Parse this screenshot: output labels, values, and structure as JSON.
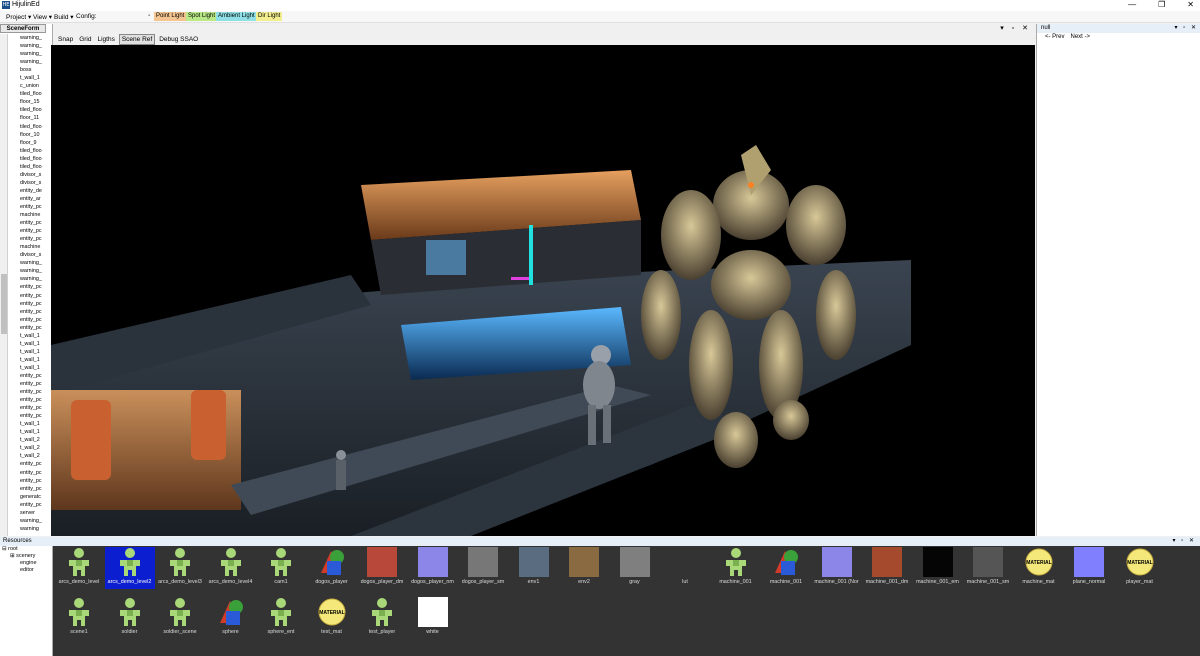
{
  "window": {
    "title": "HijulinEd",
    "app_icon": "HE",
    "btn_minimize": "—",
    "btn_maximize": "❐",
    "btn_close": "✕"
  },
  "menu": {
    "project": "Project ▾",
    "view": "View ▾",
    "build": "Build ▾",
    "config": "Config:",
    "point_light": "Point Light",
    "spot_light": "Spot Light",
    "ambient_light": "Ambient Light",
    "dir_light": "Dir Light"
  },
  "colors": {
    "point_light": "#f4c590",
    "spot_light": "#b8e986",
    "ambient_light": "#8fe0e6",
    "dir_light": "#f4ef8e",
    "selection": "#0c1fd0"
  },
  "scene_form": {
    "tab_label": "SceneForm",
    "items": [
      "warning_",
      "warning_",
      "warning_",
      "warning_",
      "boss",
      "t_wall_1",
      "c_union",
      "tiled_floo",
      "floor_15",
      "tiled_floo",
      "floor_11",
      "tiled_floo",
      "floor_10",
      "floor_9",
      "tiled_floo",
      "tiled_floo",
      "tiled_floo",
      "divisor_s",
      "divisor_s",
      "entity_de",
      "entity_ar",
      "entity_pc",
      "machine",
      "entity_pc",
      "entity_pc",
      "entity_pc",
      "machine",
      "divisor_s",
      "warning_",
      "warning_",
      "warning_",
      "entity_pc",
      "entity_pc",
      "entity_pc",
      "entity_pc",
      "entity_pc",
      "entity_pc",
      "t_wall_1",
      "t_wall_1",
      "t_wall_1",
      "t_wall_1",
      "t_wall_1",
      "entity_pc",
      "entity_pc",
      "entity_pc",
      "entity_pc",
      "entity_pc",
      "entity_pc",
      "t_wall_1",
      "t_wall_1",
      "t_wall_2",
      "t_wall_2",
      "t_wall_2",
      "entity_pc",
      "entity_pc",
      "entity_pc",
      "entity_pc",
      "generatc",
      "entity_pc",
      "server",
      "warning_",
      "warning"
    ]
  },
  "center_toolbar": {
    "snap": "Snap",
    "grid": "Grid",
    "lights": "Ligths",
    "scene_ref": "Scene Ref",
    "debug_ssao": "Debug SSAO",
    "header_icons": "▾ ▫ ✕"
  },
  "right_panel": {
    "title": "null",
    "prev": "<- Prev",
    "next": "Next ->",
    "header_icons": "▾ ▫ ✕"
  },
  "resources": {
    "title": "Resources",
    "header_icons": "▾ ▫ ✕",
    "tree": [
      "⊟ root",
      "⊞ scenery",
      "engine",
      "editor"
    ],
    "items": [
      {
        "label": "arcs_demo_level",
        "icon": "scene-icon"
      },
      {
        "label": "arcs_demo_level2",
        "icon": "scene-icon",
        "selected": true
      },
      {
        "label": "arcs_demo_level3",
        "icon": "scene-icon"
      },
      {
        "label": "arcs_demo_level4",
        "icon": "scene-icon"
      },
      {
        "label": "cam1",
        "icon": "scene-icon"
      },
      {
        "label": "dogos_player",
        "icon": "mesh-icon"
      },
      {
        "label": "dogos_player_dm",
        "icon": "texture-icon",
        "color": "#b8483a"
      },
      {
        "label": "dogos_player_nm",
        "icon": "texture-icon",
        "color": "#8b86e8"
      },
      {
        "label": "dogos_player_sm",
        "icon": "texture-icon",
        "color": "#777777"
      },
      {
        "label": "env1",
        "icon": "texture-icon",
        "color": "#5a6c80"
      },
      {
        "label": "env2",
        "icon": "texture-icon",
        "color": "#8a6a40"
      },
      {
        "label": "gray",
        "icon": "texture-icon",
        "color": "#7f7f7f"
      },
      {
        "label": "lut",
        "icon": "texture-icon",
        "color": "#333333"
      },
      {
        "label": "machine_001",
        "icon": "scene-icon"
      },
      {
        "label": "machine_001",
        "icon": "mesh-icon"
      },
      {
        "label": "machine_001 (Nor",
        "icon": "texture-icon",
        "color": "#8b86e8"
      },
      {
        "label": "machine_001_dm",
        "icon": "texture-icon",
        "color": "#a64a2e"
      },
      {
        "label": "machine_001_em",
        "icon": "texture-icon",
        "color": "#050505"
      },
      {
        "label": "machine_001_sm",
        "icon": "texture-icon",
        "color": "#555555"
      },
      {
        "label": "machine_mat",
        "icon": "material-icon"
      },
      {
        "label": "plane_normal",
        "icon": "texture-icon",
        "color": "#8080ff"
      },
      {
        "label": "player_mat",
        "icon": "material-icon"
      },
      {
        "label": "scene1",
        "icon": "scene-icon"
      },
      {
        "label": "soldier",
        "icon": "scene-icon"
      },
      {
        "label": "soldier_scene",
        "icon": "scene-icon"
      },
      {
        "label": "sphere",
        "icon": "mesh-icon"
      },
      {
        "label": "sphere_ent",
        "icon": "scene-icon"
      },
      {
        "label": "test_mat",
        "icon": "material-icon"
      },
      {
        "label": "test_player",
        "icon": "scene-icon"
      },
      {
        "label": "white",
        "icon": "texture-icon",
        "color": "#ffffff"
      }
    ],
    "material_text": "MATERIAL"
  }
}
